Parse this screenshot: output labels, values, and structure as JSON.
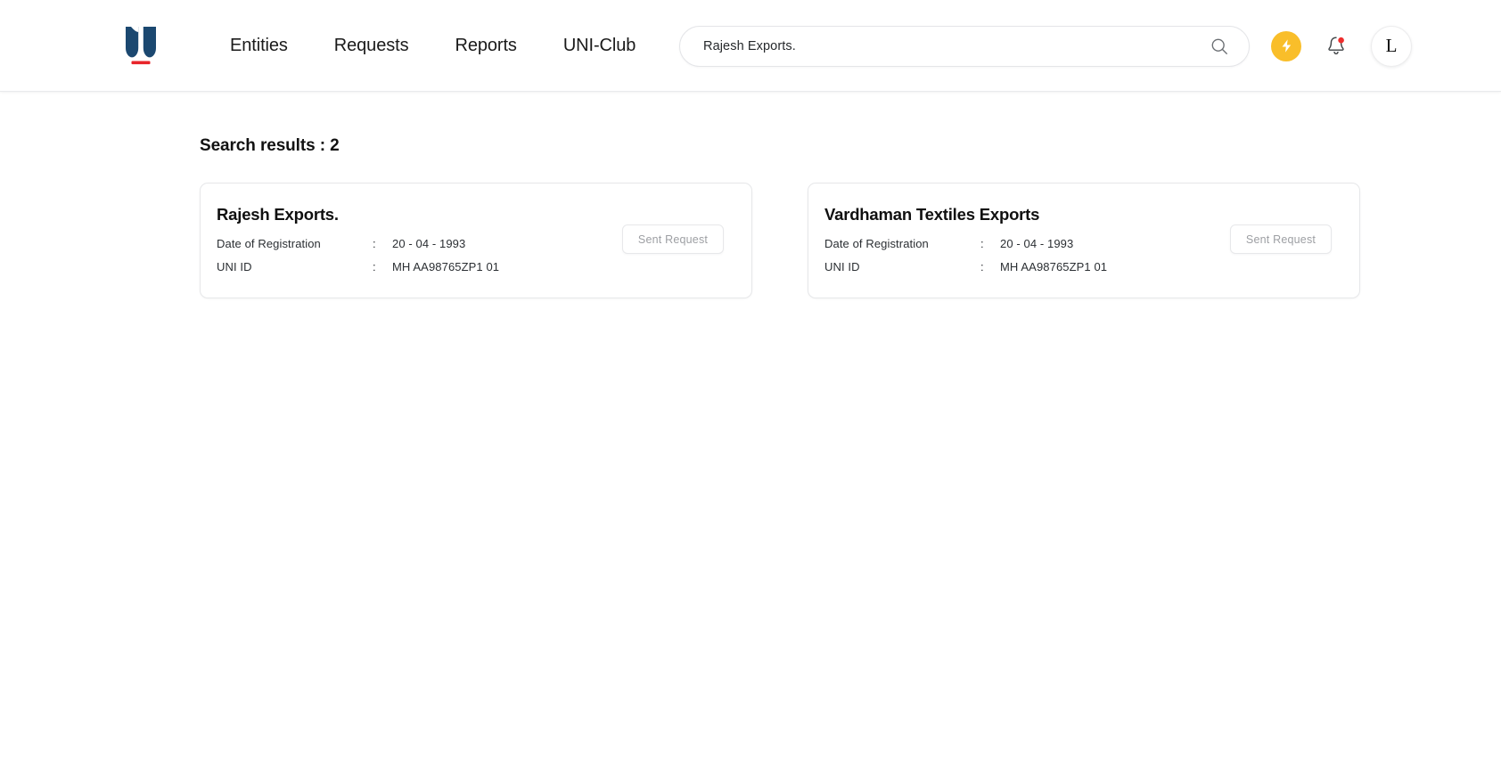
{
  "brand": {
    "logo_icon": "uni-shield-logo",
    "logo_color": "#1B4870",
    "logo_accent_color": "#E8242A"
  },
  "nav": {
    "items": [
      {
        "label": "Entities",
        "name": "nav-item-entities"
      },
      {
        "label": "Requests",
        "name": "nav-item-requests"
      },
      {
        "label": "Reports",
        "name": "nav-item-reports"
      },
      {
        "label": "UNI-Club",
        "name": "nav-item-uni-club"
      }
    ]
  },
  "search": {
    "value": "Rajesh Exports.",
    "placeholder": "Search",
    "icon": "search-icon"
  },
  "actions": {
    "bolt": {
      "icon": "lightning-bolt-icon",
      "color": "#F9BE2A"
    },
    "bell": {
      "icon": "notification-bell-icon",
      "badge_color": "#EE2D2D",
      "has_badge": true
    },
    "avatar": {
      "initial": "L"
    }
  },
  "main": {
    "results_heading": "Search results : 2",
    "field_labels": {
      "date_of_registration": "Date of Registration",
      "uni_id": "UNI ID",
      "separator": ":"
    },
    "action_label": "Sent Request",
    "cards": [
      {
        "title": "Rajesh Exports.",
        "date_of_registration": "20 - 04 - 1993",
        "uni_id": "MH AA98765ZP1 01",
        "action_label": "Sent Request"
      },
      {
        "title": "Vardhaman Textiles Exports",
        "date_of_registration": "20 - 04 - 1993",
        "uni_id": "MH AA98765ZP1 01",
        "action_label": "Sent Request"
      }
    ]
  }
}
